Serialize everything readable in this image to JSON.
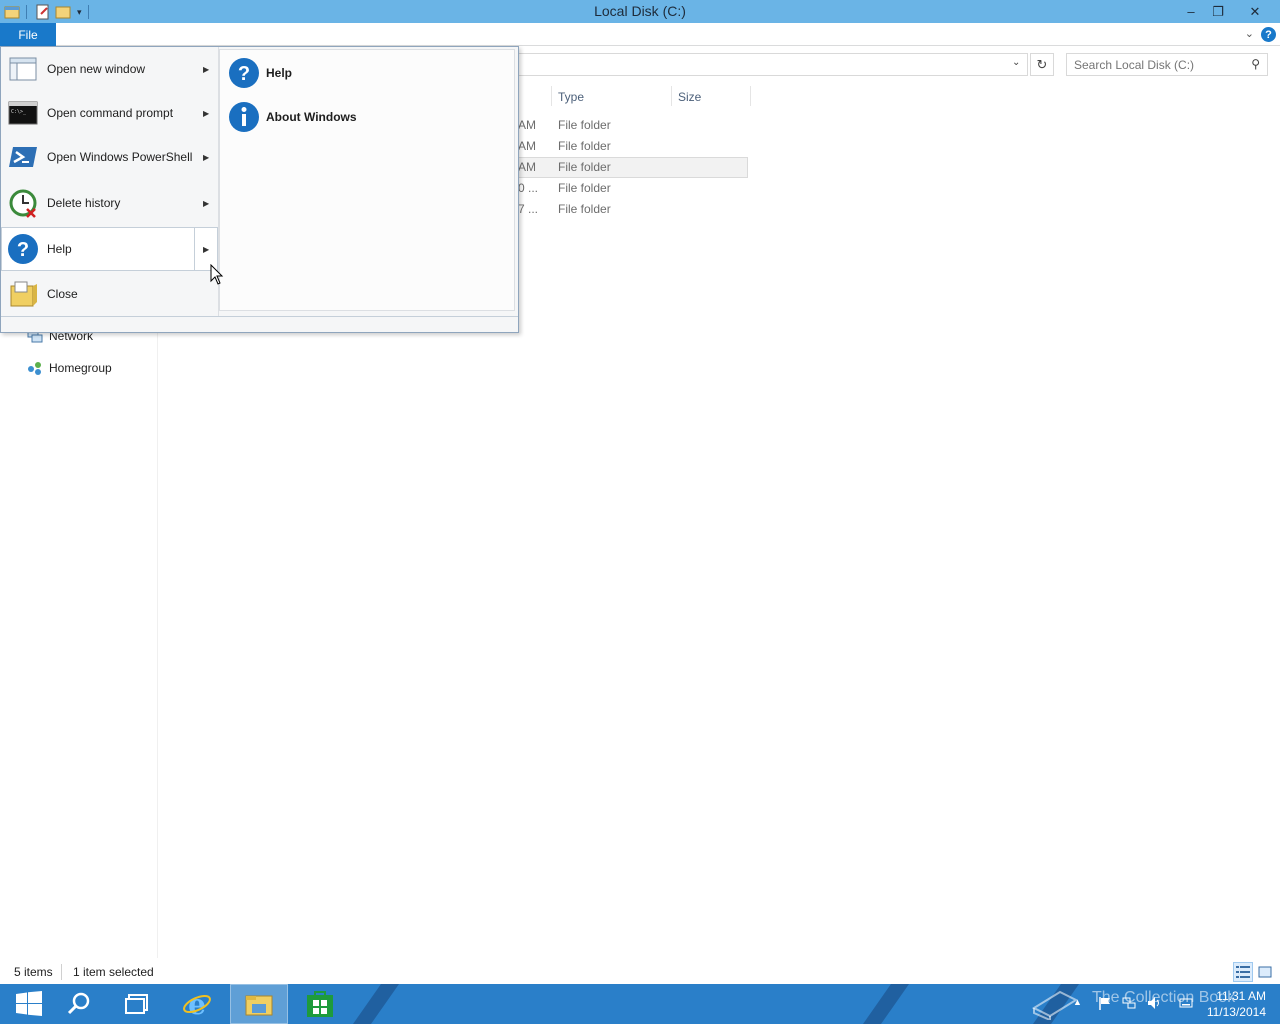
{
  "window": {
    "title": "Local Disk (C:)",
    "minimize": "–",
    "restore": "❐",
    "close": "✕"
  },
  "ribbon": {
    "file_tab": "File",
    "help": "?"
  },
  "address": {
    "search_placeholder": "Search Local Disk (C:)"
  },
  "file_menu": {
    "items": [
      {
        "label": "Open new window",
        "icon": "window-icon",
        "has_submenu": true
      },
      {
        "label": "Open command prompt",
        "icon": "command-prompt-icon",
        "has_submenu": true
      },
      {
        "label": "Open Windows PowerShell",
        "icon": "powershell-icon",
        "has_submenu": true
      },
      {
        "label": "Delete history",
        "icon": "history-icon",
        "has_submenu": true
      },
      {
        "label": "Help",
        "icon": "help-icon",
        "has_submenu": true
      },
      {
        "label": "Close",
        "icon": "close-folder-icon",
        "has_submenu": false
      }
    ],
    "submenu": [
      {
        "label": "Help",
        "icon": "help-icon"
      },
      {
        "label": "About Windows",
        "icon": "info-icon"
      }
    ]
  },
  "file_list": {
    "columns": [
      "Type",
      "Size"
    ],
    "rows": [
      {
        "date_fragment": "AM",
        "type": "File folder"
      },
      {
        "date_fragment": "AM",
        "type": "File folder"
      },
      {
        "date_fragment": "AM",
        "type": "File folder"
      },
      {
        "date_fragment": "0 ...",
        "type": "File folder"
      },
      {
        "date_fragment": "7 ...",
        "type": "File folder"
      }
    ]
  },
  "nav": {
    "items": [
      "Network",
      "Homegroup"
    ]
  },
  "status": {
    "item_count": "5 items",
    "selection": "1 item selected"
  },
  "taskbar": {
    "watermark": "The Collection Book",
    "time": "11:31 AM",
    "date": "11/13/2014"
  },
  "colors": {
    "titlebar": "#6ab4e6",
    "accent": "#1979ca",
    "taskbar": "#2a7fc9"
  }
}
